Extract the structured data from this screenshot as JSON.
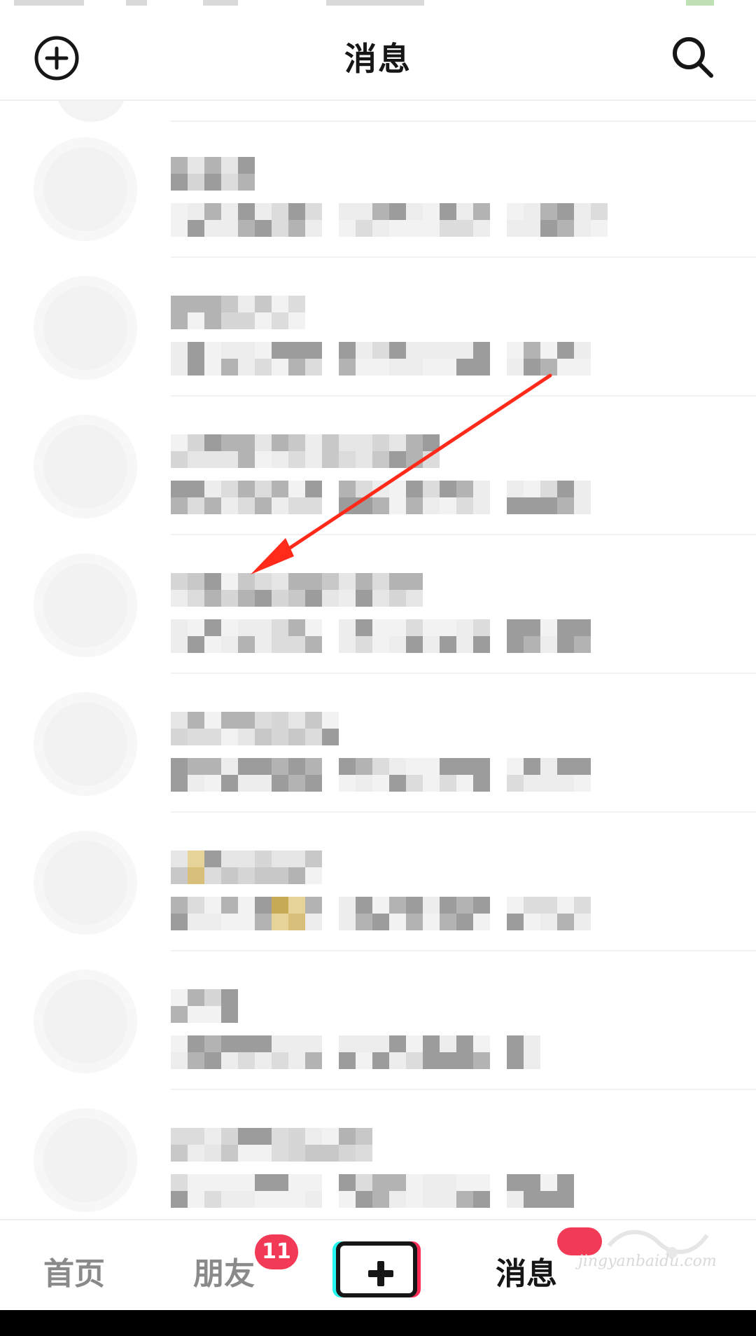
{
  "header": {
    "title": "消息",
    "left_icon": "add-circle-icon",
    "right_icon": "search-icon"
  },
  "conversations": [
    {
      "name_hidden": true,
      "preview_hidden": true
    },
    {
      "name_hidden": true,
      "preview_hidden": true
    },
    {
      "name_hidden": true,
      "preview_hidden": true
    },
    {
      "name_hidden": true,
      "preview_hidden": true
    },
    {
      "name_hidden": true,
      "preview_hidden": true
    },
    {
      "name_hidden": true,
      "preview_hidden": true
    },
    {
      "name_hidden": true,
      "preview_hidden": true
    },
    {
      "name_hidden": true,
      "preview_hidden": true
    }
  ],
  "bottom_nav": {
    "home": "首页",
    "friends": "朋友",
    "friends_badge": "11",
    "create_icon": "plus-icon",
    "messages": "消息",
    "me_icon": "profile-icon"
  },
  "annotation": {
    "color": "#ff2a1a",
    "icon": "arrow"
  },
  "watermark": {
    "text": "jingyanbaidu.com"
  },
  "colors": {
    "accent": "#f23a56",
    "text_primary": "#161616",
    "text_secondary": "#8a8a8a"
  }
}
